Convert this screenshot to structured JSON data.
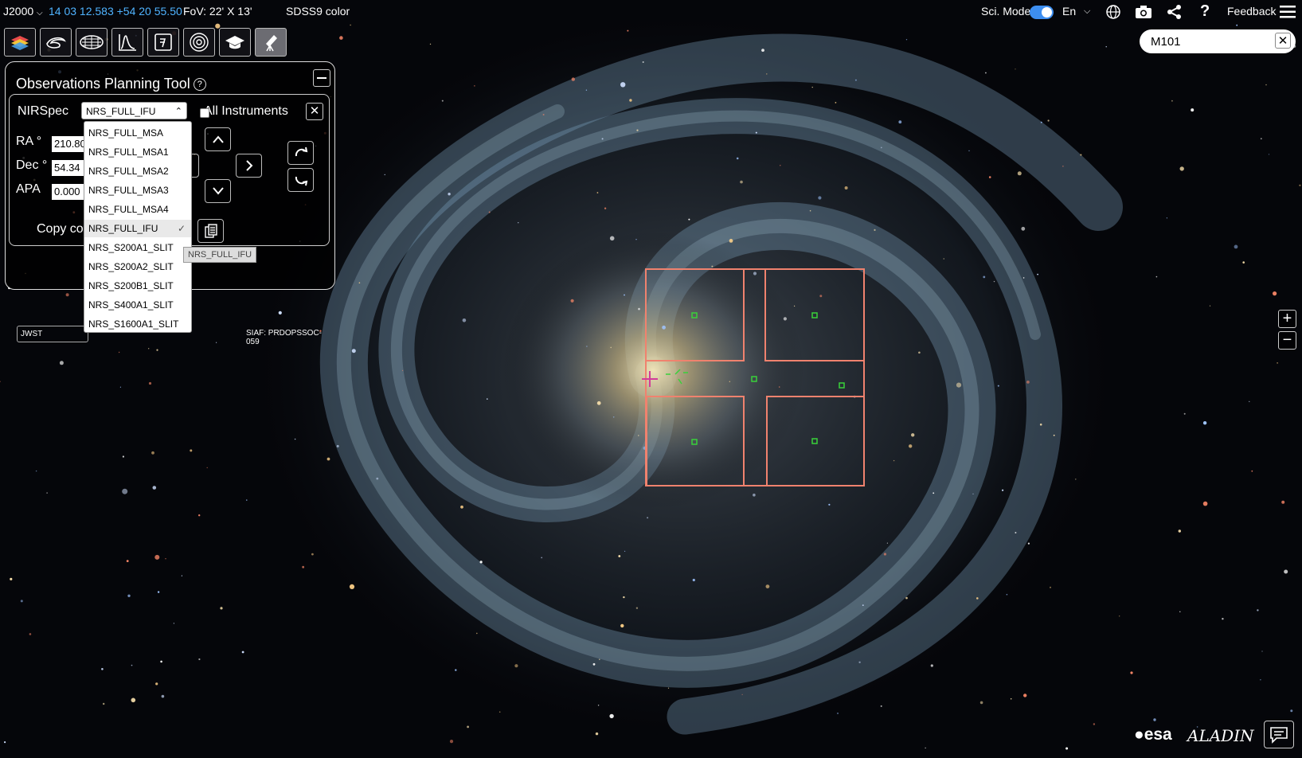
{
  "topbar": {
    "frame": "J2000",
    "coordinates": "14 03 12.583 +54 20 55.50",
    "fov": "FoV: 22' X 13'",
    "survey": "SDSS9 color",
    "sci_mode_label": "Sci. Mode",
    "sci_mode_on": true,
    "language": "En",
    "feedback": "Feedback"
  },
  "toolbar_icons": [
    "layers-icon",
    "galaxy-icon",
    "planet-survey-icon",
    "spectrum-icon",
    "target-icon",
    "explore-icon",
    "education-icon",
    "telescope-icon"
  ],
  "search": {
    "value": "M101"
  },
  "panel": {
    "title": "Observations Planning Tool",
    "instrument": "NIRSpec",
    "selected_aperture": "NRS_FULL_IFU",
    "all_instruments_label": "All Instruments",
    "ra_label": "RA °",
    "ra_value": "210.80",
    "dec_label": "Dec °",
    "dec_value": "54.34",
    "apa_label": "APA",
    "apa_value": "0.000",
    "copy_label": "Copy co",
    "mission": "JWST",
    "siaf": "SIAF: PRDOPSSOC-059",
    "tooltip": "NRS_FULL_IFU"
  },
  "apertures": [
    "NRS_FULL_MSA",
    "NRS_FULL_MSA1",
    "NRS_FULL_MSA2",
    "NRS_FULL_MSA3",
    "NRS_FULL_MSA4",
    "NRS_FULL_IFU",
    "NRS_S200A1_SLIT",
    "NRS_S200A2_SLIT",
    "NRS_S200B1_SLIT",
    "NRS_S400A1_SLIT",
    "NRS_S1600A1_SLIT"
  ],
  "selected_index": 5,
  "footer": {
    "esa": "esa",
    "aladin": "ALADIN"
  },
  "colors": {
    "accent": "#4fb3ff",
    "footprint": "#f0826e",
    "marker": "#39d13a"
  }
}
